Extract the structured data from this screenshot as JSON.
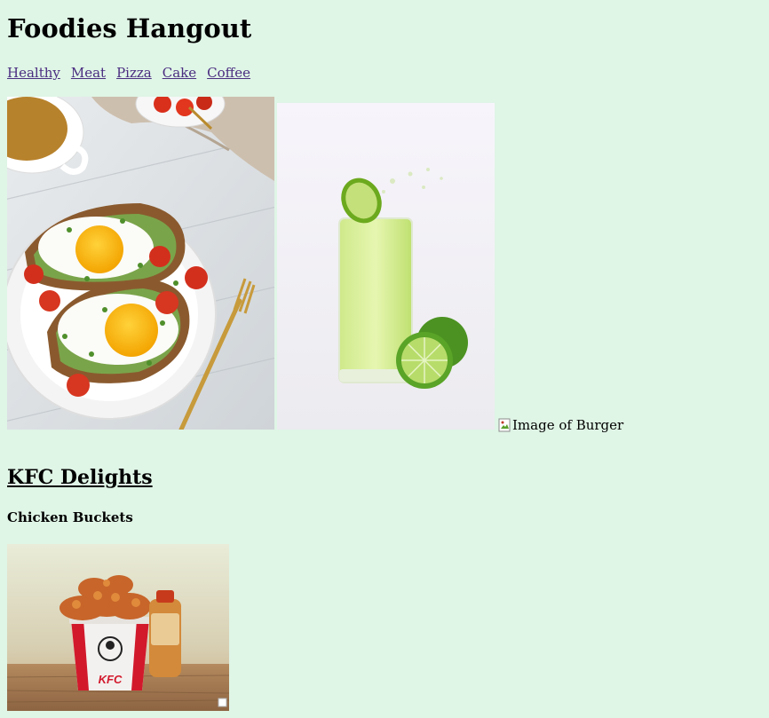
{
  "site": {
    "title": "Foodies Hangout"
  },
  "nav": {
    "items": [
      {
        "label": "Healthy"
      },
      {
        "label": "Meat"
      },
      {
        "label": "Pizza"
      },
      {
        "label": "Cake"
      },
      {
        "label": "Coffee"
      }
    ]
  },
  "gallery": {
    "broken_image_alt": "Image of Burger"
  },
  "section": {
    "title": "KFC Delights",
    "subtitle": "Chicken Buckets",
    "bucket_brand": "KFC"
  },
  "colors": {
    "background": "#dff5e6",
    "link": "#4a2d80"
  }
}
